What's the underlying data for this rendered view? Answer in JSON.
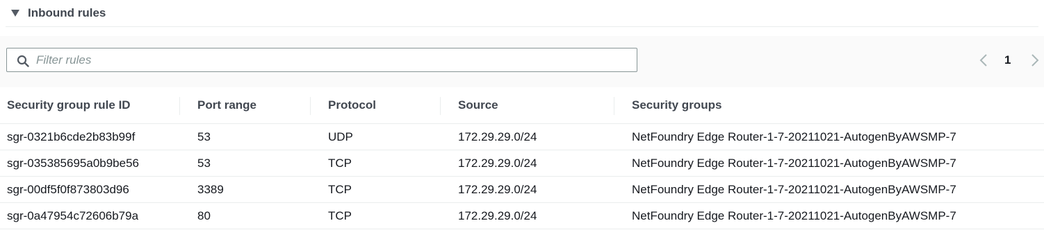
{
  "section": {
    "title": "Inbound rules"
  },
  "filter": {
    "placeholder": "Filter rules",
    "value": ""
  },
  "pagination": {
    "current_page": "1"
  },
  "table": {
    "columns": [
      "Security group rule ID",
      "Port range",
      "Protocol",
      "Source",
      "Security groups"
    ],
    "rows": [
      [
        "sgr-0321b6cde2b83b99f",
        "53",
        "UDP",
        "172.29.29.0/24",
        "NetFoundry Edge Router-1-7-20211021-AutogenByAWSMP-7"
      ],
      [
        "sgr-035385695a0b9be56",
        "53",
        "TCP",
        "172.29.29.0/24",
        "NetFoundry Edge Router-1-7-20211021-AutogenByAWSMP-7"
      ],
      [
        "sgr-00df5f0f873803d96",
        "3389",
        "TCP",
        "172.29.29.0/24",
        "NetFoundry Edge Router-1-7-20211021-AutogenByAWSMP-7"
      ],
      [
        "sgr-0a47954c72606b79a",
        "80",
        "TCP",
        "172.29.29.0/24",
        "NetFoundry Edge Router-1-7-20211021-AutogenByAWSMP-7"
      ]
    ]
  },
  "icons": {
    "expand": "caret-down-icon",
    "search": "search-icon",
    "prev": "chevron-left-icon",
    "next": "chevron-right-icon"
  },
  "colors": {
    "header_text": "#414750",
    "border": "#879596",
    "toolbar_bg": "#fafafa",
    "divider": "#eaeded"
  }
}
